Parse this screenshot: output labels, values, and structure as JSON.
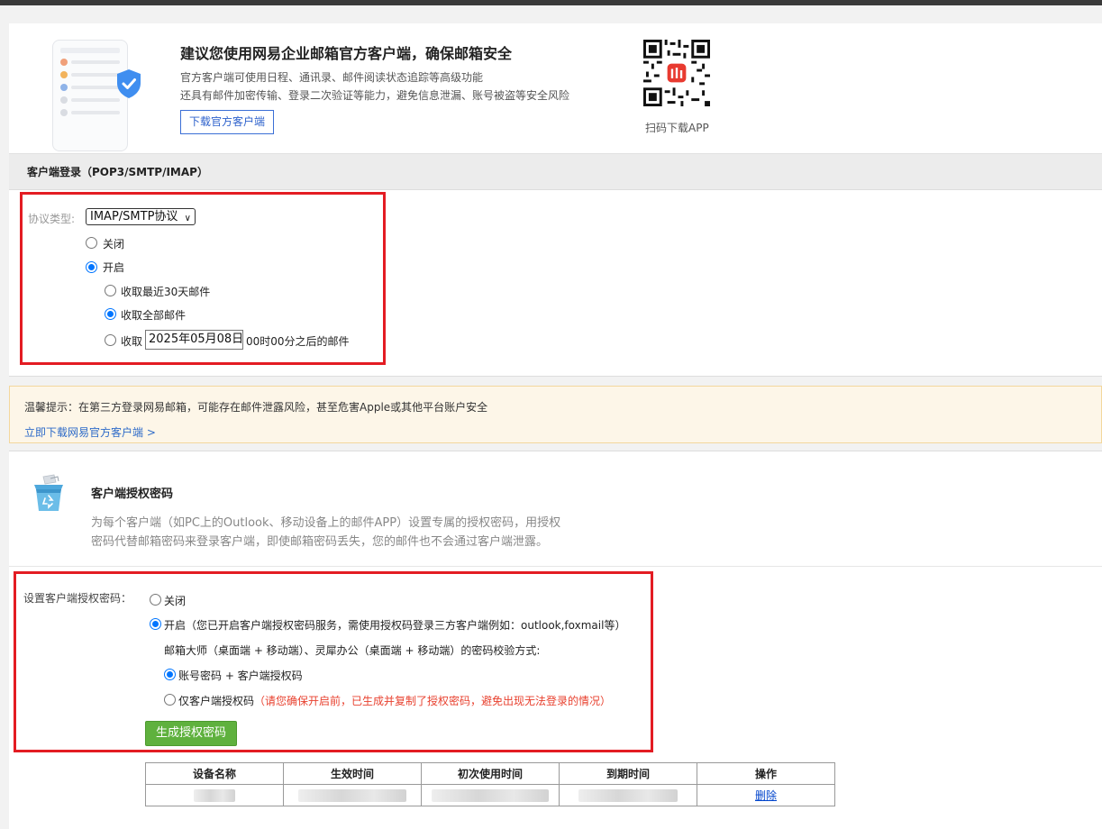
{
  "promo": {
    "title": "建议您使用网易企业邮箱官方客户端，确保邮箱安全",
    "line1": "官方客户端可使用日程、通讯录、邮件阅读状态追踪等高级功能",
    "line2": "还具有邮件加密传输、登录二次验证等能力，避免信息泄漏、账号被盗等安全风险",
    "download_button": "下载官方客户端",
    "qr_label": "扫码下载APP"
  },
  "client_login": {
    "header": "客户端登录（POP3/SMTP/IMAP）",
    "protocol_label": "协议类型:",
    "protocol_value": "IMAP/SMTP协议",
    "off_label": "关闭",
    "on_label": "开启",
    "enabled": true,
    "fetch_recent_label": "收取最近30天邮件",
    "fetch_all_label": "收取全部邮件",
    "fetch_since_prefix": "收取",
    "fetch_since_date": "2025年05月08日",
    "fetch_since_suffix": "00时00分之后的邮件",
    "fetch_mode": "all"
  },
  "warning": {
    "text": "温馨提示：在第三方登录网易邮箱，可能存在邮件泄露风险，甚至危害Apple或其他平台账户安全",
    "link": "立即下载网易官方客户端 >"
  },
  "auth_code": {
    "title": "客户端授权密码",
    "desc_line1": "为每个客户端（如PC上的Outlook、移动设备上的邮件APP）设置专属的授权密码，用授权",
    "desc_line2": "密码代替邮箱密码来登录客户端，即使邮箱密码丢失，您的邮件也不会通过客户端泄露。",
    "setting_label": "设置客户端授权密码：",
    "off_label": "关闭",
    "on_label": "开启（您已开启客户端授权密码服务，需使用授权码登录三方客户端例如：outlook,foxmail等）",
    "enabled": true,
    "verify_intro": "邮箱大师（桌面端 + 移动端）、灵犀办公（桌面端 + 移动端）的密码校验方式:",
    "opt_account_label": "账号密码 + 客户端授权码",
    "opt_only_label": "仅客户端授权码",
    "opt_only_note": "（请您确保开启前，已生成并复制了授权密码，避免出现无法登录的情况）",
    "verify_mode": "account",
    "generate_button": "生成授权密码"
  },
  "devices_table": {
    "headers": [
      "设备名称",
      "生效时间",
      "初次使用时间",
      "到期时间",
      "操作"
    ],
    "rows": [
      {
        "action": "删除"
      }
    ]
  },
  "colors": {
    "highlight_border": "#e31c23",
    "accent_blue": "#0075ff",
    "generate_green": "#5fb13e",
    "warning_bg": "#fdf6e8"
  }
}
